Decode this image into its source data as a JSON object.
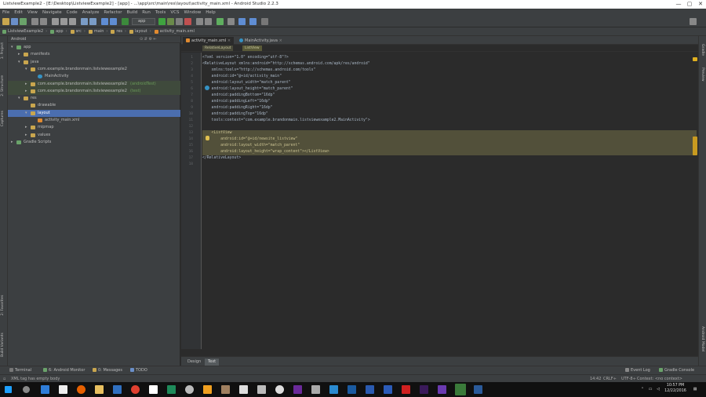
{
  "window": {
    "title": "ListviewExample2 - [E:\\Desktop\\ListviewExample2] - [app] - ...\\app\\src\\main\\res\\layout\\activity_main.xml - Android Studio 2.2.3",
    "minimize": "—",
    "maximize": "▢",
    "close": "✕"
  },
  "menu": [
    "File",
    "Edit",
    "View",
    "Navigate",
    "Code",
    "Analyze",
    "Refactor",
    "Build",
    "Run",
    "Tools",
    "VCS",
    "Window",
    "Help"
  ],
  "toolbar": {
    "run_config": "app"
  },
  "breadcrumbs": [
    "ListviewExample2",
    "app",
    "src",
    "main",
    "res",
    "layout",
    "activity_main.xml"
  ],
  "left_tool_tabs": [
    "1: Project",
    "2: Structure",
    "Captures",
    "2: Favorites",
    "Build Variants"
  ],
  "right_tool_tabs": [
    "Gradle",
    "Preview",
    "Android Model"
  ],
  "project": {
    "view": "Android",
    "tree": [
      {
        "label": "app",
        "level": 0,
        "arrow": "▾",
        "icon": "module"
      },
      {
        "label": "manifests",
        "level": 1,
        "arrow": "▸",
        "icon": "folder"
      },
      {
        "label": "java",
        "level": 1,
        "arrow": "▾",
        "icon": "folder"
      },
      {
        "label": "com.example.brandonmain.listviewexample2",
        "level": 2,
        "arrow": "▾",
        "icon": "package"
      },
      {
        "label": "MainActivity",
        "level": 3,
        "arrow": "",
        "icon": "class"
      },
      {
        "label": "com.example.brandonmain.listviewexample2",
        "suffix": "(androidTest)",
        "level": 2,
        "arrow": "▸",
        "icon": "package",
        "highlight": true
      },
      {
        "label": "com.example.brandonmain.listviewexample2",
        "suffix": "(test)",
        "level": 2,
        "arrow": "▸",
        "icon": "package",
        "highlight": true
      },
      {
        "label": "res",
        "level": 1,
        "arrow": "▾",
        "icon": "folder"
      },
      {
        "label": "drawable",
        "level": 2,
        "arrow": "",
        "icon": "folder"
      },
      {
        "label": "layout",
        "level": 2,
        "arrow": "▾",
        "icon": "folder",
        "selected": true
      },
      {
        "label": "activity_main.xml",
        "level": 3,
        "arrow": "",
        "icon": "xml"
      },
      {
        "label": "mipmap",
        "level": 2,
        "arrow": "▸",
        "icon": "folder"
      },
      {
        "label": "values",
        "level": 2,
        "arrow": "▸",
        "icon": "folder"
      },
      {
        "label": "Gradle Scripts",
        "level": 0,
        "arrow": "▸",
        "icon": "gradle"
      }
    ]
  },
  "editor_tabs": [
    {
      "label": "activity_main.xml",
      "active": true
    },
    {
      "label": "MainActivity.java",
      "active": false
    }
  ],
  "xml_breadcrumbs": [
    "RelativeLayout",
    "ListView"
  ],
  "code_lines": [
    "<?xml version=\"1.0\" encoding=\"utf-8\"?>",
    "<RelativeLayout xmlns:android=\"http://schemas.android.com/apk/res/android\"",
    "    xmlns:tools=\"http://schemas.android.com/tools\"",
    "    android:id=\"@+id/activity_main\"",
    "    android:layout_width=\"match_parent\"",
    "    android:layout_height=\"match_parent\"",
    "    android:paddingBottom=\"16dp\"",
    "    android:paddingLeft=\"16dp\"",
    "    android:paddingRight=\"16dp\"",
    "    android:paddingTop=\"16dp\"",
    "    tools:context=\"com.example.brandonmain.listviewexample2.MainActivity\">",
    "",
    "    <ListView",
    "        android:id=\"@+id/newsite_listview\"",
    "        android:layout_width=\"match_parent\"",
    "        android:layout_height=\"wrap_content\"></ListView>",
    "</RelativeLayout>",
    ""
  ],
  "design_tabs": [
    {
      "label": "Design",
      "active": false
    },
    {
      "label": "Text",
      "active": true
    }
  ],
  "tool_windows": {
    "left": [
      "Terminal",
      "6: Android Monitor",
      "0: Messages",
      "TODO"
    ],
    "right": [
      "Event Log",
      "Gradle Console"
    ]
  },
  "status": {
    "message": "XML tag has empty body",
    "position": "14:42",
    "line_sep": "CRLF÷",
    "encoding": "UTF-8÷",
    "context": "Context: <no context>"
  },
  "taskbar": {
    "time": "10:57 PM",
    "date": "12/22/2016"
  },
  "colors": {
    "accent": "#4b6eaf",
    "highlight_line": "#52503a"
  }
}
